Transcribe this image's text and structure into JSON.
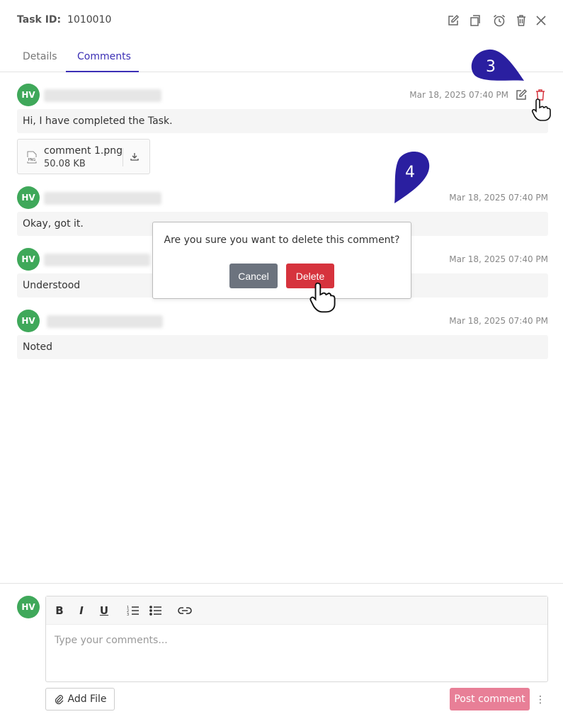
{
  "header": {
    "task_label": "Task ID:",
    "task_id": "1010010"
  },
  "header_icons": [
    "edit-icon",
    "copy-icon",
    "alarm-icon",
    "trash-icon",
    "close-icon"
  ],
  "tabs": [
    {
      "label": "Details"
    },
    {
      "label": "Comments"
    }
  ],
  "active_tab": "Comments",
  "comments": [
    {
      "initials": "HV",
      "timestamp": "Mar 18, 2025 07:40 PM",
      "text": "Hi, I have completed the Task.",
      "attachment": {
        "filename": "comment 1.png",
        "size": "50.08 KB",
        "type_label": "PNG"
      }
    },
    {
      "initials": "HV",
      "timestamp": "Mar 18, 2025 07:40 PM",
      "text": "Okay, got it."
    },
    {
      "initials": "HV",
      "timestamp": "Mar 18, 2025 07:40 PM",
      "text": "Understood"
    },
    {
      "initials": "HV",
      "timestamp": "Mar 18, 2025 07:40 PM",
      "text": "Noted"
    }
  ],
  "dialog": {
    "message": "Are you sure you want to delete this comment?",
    "cancel_label": "Cancel",
    "delete_label": "Delete"
  },
  "markers": {
    "step3": "3",
    "step4": "4"
  },
  "composer": {
    "initials": "HV",
    "placeholder": "Type your comments...",
    "toolbar": [
      "bold-icon",
      "italic-icon",
      "underline-icon",
      "ordered-list-icon",
      "bullet-list-icon",
      "link-icon"
    ],
    "add_file_label": "Add File",
    "post_label": "Post comment"
  },
  "colors": {
    "accent": "#3b2fb5",
    "avatar": "#3fa85a",
    "delete": "#d6333d",
    "cancel": "#6c737e",
    "post": "#e87f97",
    "marker": "#2a1fa0"
  }
}
